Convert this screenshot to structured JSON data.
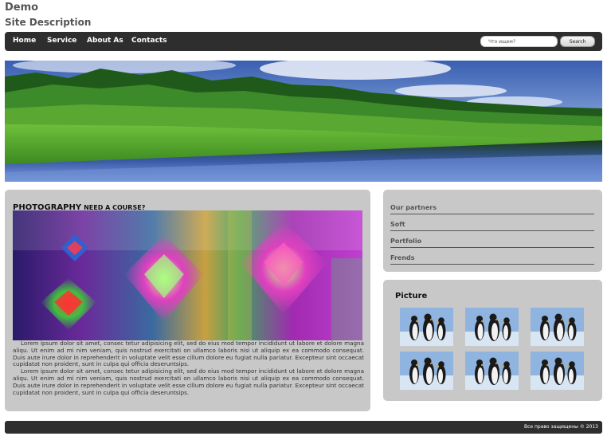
{
  "header": {
    "title": "Demo",
    "description": "Site Description"
  },
  "nav": {
    "items": [
      {
        "label": "Home"
      },
      {
        "label": "Service"
      },
      {
        "label": "About As"
      },
      {
        "label": "Contacts"
      }
    ],
    "search_placeholder": "Что ищем?",
    "search_button": "Search"
  },
  "main": {
    "heading": "PHOTOGRAPHY",
    "subheading": "NEED A COURSE?",
    "paragraphs": [
      "Lorem ipsum dolor sit amet, consec tetur adipisicing elit, sed do eius mod tempor incididunt ut labore et dolore magna aliqu. Ut enim ad mi nim veniam, quis nostrud exercitati on ullamco laboris nisi ut aliquip ex ea commodo consequat. Duis aute irure dolor in reprehenderit in voluptate velit esse cillum dolore eu fugiat nulla pariatur. Excepteur sint occaecat cupidatat non proident, sunt in culpa qui officia deseruntsips.",
      "Lorem ipsum dolor sit amet, consec tetur adipisicing elit, sed do eius mod tempor incididunt ut labore et dolore magna aliqu. Ut enim ad mi nim veniam, quis nostrud exercitati on ullamco laboris nisi ut aliquip ex ea commodo consequat. Duis aute irure dolor in reprehenderit in voluptate velit esse cillum dolore eu fugiat nulla pariatur. Excepteur sint occaecat cupidatat non proident, sunt in culpa qui officia deseruntsips."
    ]
  },
  "sidebar": {
    "partners": [
      {
        "label": "Our partners"
      },
      {
        "label": "Soft"
      },
      {
        "label": "Portfolio"
      },
      {
        "label": "Frends"
      }
    ],
    "picture_title": "Picture"
  },
  "footer": {
    "text": "Все право защищены © 2013"
  },
  "colors": {
    "navbar": "#2e2e2e",
    "panel": "#c8c8c8",
    "page_bg": "#ffffff"
  }
}
